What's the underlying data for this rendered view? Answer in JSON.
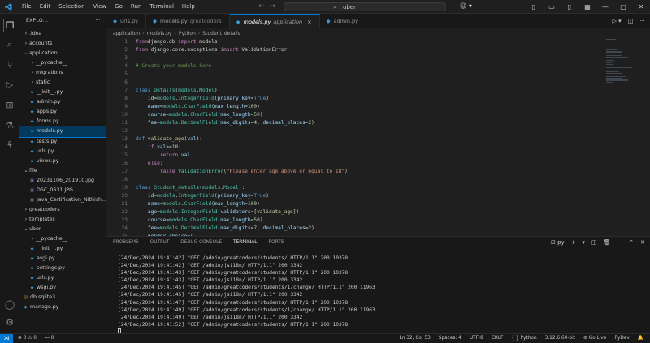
{
  "titlebar": {
    "menu": [
      "File",
      "Edit",
      "Selection",
      "View",
      "Go",
      "Run",
      "Terminal",
      "Help"
    ],
    "search": "uber"
  },
  "sidebar": {
    "header": "EXPLO...",
    "tree": [
      {
        "label": ".idea",
        "indent": 0,
        "kind": "folder",
        "open": false
      },
      {
        "label": "accounts",
        "indent": 0,
        "kind": "folder",
        "open": false
      },
      {
        "label": "application",
        "indent": 0,
        "kind": "folder",
        "open": true
      },
      {
        "label": "__pycache__",
        "indent": 1,
        "kind": "folder",
        "open": false
      },
      {
        "label": "migrations",
        "indent": 1,
        "kind": "folder",
        "open": false
      },
      {
        "label": "static",
        "indent": 1,
        "kind": "folder",
        "open": false
      },
      {
        "label": "__init__.py",
        "indent": 1,
        "kind": "py"
      },
      {
        "label": "admin.py",
        "indent": 1,
        "kind": "py"
      },
      {
        "label": "apps.py",
        "indent": 1,
        "kind": "py"
      },
      {
        "label": "forms.py",
        "indent": 1,
        "kind": "py"
      },
      {
        "label": "models.py",
        "indent": 1,
        "kind": "py",
        "selected": true
      },
      {
        "label": "tests.py",
        "indent": 1,
        "kind": "py"
      },
      {
        "label": "urls.py",
        "indent": 1,
        "kind": "py"
      },
      {
        "label": "views.py",
        "indent": 1,
        "kind": "py"
      },
      {
        "label": "file",
        "indent": 0,
        "kind": "folder",
        "open": true
      },
      {
        "label": "20231106_201910.jpg",
        "indent": 1,
        "kind": "img"
      },
      {
        "label": "DSC_0631.JPG",
        "indent": 1,
        "kind": "img"
      },
      {
        "label": "Java_Certification_Nithish...",
        "indent": 1,
        "kind": "img"
      },
      {
        "label": "greatcoders",
        "indent": 0,
        "kind": "folder",
        "open": false
      },
      {
        "label": "templates",
        "indent": 0,
        "kind": "folder",
        "open": false
      },
      {
        "label": "uber",
        "indent": 0,
        "kind": "folder",
        "open": true
      },
      {
        "label": "__pycache__",
        "indent": 1,
        "kind": "folder",
        "open": false
      },
      {
        "label": "__init__.py",
        "indent": 1,
        "kind": "py"
      },
      {
        "label": "asgi.py",
        "indent": 1,
        "kind": "py"
      },
      {
        "label": "settings.py",
        "indent": 1,
        "kind": "py"
      },
      {
        "label": "urls.py",
        "indent": 1,
        "kind": "py"
      },
      {
        "label": "wsgi.py",
        "indent": 1,
        "kind": "py"
      },
      {
        "label": "db.sqlite3",
        "indent": 0,
        "kind": "db"
      },
      {
        "label": "manage.py",
        "indent": 0,
        "kind": "py"
      }
    ]
  },
  "tabs": [
    {
      "name": "urls.py",
      "desc": "",
      "active": false
    },
    {
      "name": "models.py",
      "desc": "greatcoders",
      "active": false
    },
    {
      "name": "models.py",
      "desc": "application",
      "active": true
    },
    {
      "name": "admin.py",
      "desc": "",
      "active": false
    }
  ],
  "breadcrumbs": [
    "application",
    "models.py",
    "Python",
    "Student_details"
  ],
  "editor": {
    "lines": [
      [
        [
          "kw2",
          "from"
        ],
        [
          "",
          ""
        ],
        [
          " ",
          ""
        ],
        [
          "",
          "django.db "
        ],
        [
          "kw2",
          "import"
        ],
        [
          "",
          " models"
        ]
      ],
      [
        [
          "kw2",
          "from"
        ],
        [
          "",
          " django.core.exceptions "
        ],
        [
          "kw2",
          "import"
        ],
        [
          "",
          " ValidationError"
        ]
      ],
      [],
      [
        [
          "cmt",
          "# Create your models here"
        ]
      ],
      [],
      [],
      [
        [
          "kw",
          "class"
        ],
        [
          "",
          " "
        ],
        [
          "cls",
          "Details"
        ],
        [
          "",
          "("
        ],
        [
          "mod",
          "models"
        ],
        [
          "",
          "."
        ],
        [
          "cls",
          "Model"
        ],
        [
          "",
          "):"
        ]
      ],
      [
        [
          "",
          "    "
        ],
        [
          "var",
          "id"
        ],
        [
          "",
          "="
        ],
        [
          "mod",
          "models"
        ],
        [
          "",
          "."
        ],
        [
          "cls",
          "IntegerField"
        ],
        [
          "",
          "("
        ],
        [
          "var",
          "primary_key"
        ],
        [
          "",
          "="
        ],
        [
          "const",
          "True"
        ],
        [
          "",
          ")"
        ]
      ],
      [
        [
          "",
          "    "
        ],
        [
          "var",
          "name"
        ],
        [
          "",
          "="
        ],
        [
          "mod",
          "models"
        ],
        [
          "",
          "."
        ],
        [
          "cls",
          "CharField"
        ],
        [
          "",
          "("
        ],
        [
          "var",
          "max_length"
        ],
        [
          "",
          "="
        ],
        [
          "num",
          "100"
        ],
        [
          "",
          ")"
        ]
      ],
      [
        [
          "",
          "    "
        ],
        [
          "var",
          "course"
        ],
        [
          "",
          "="
        ],
        [
          "mod",
          "models"
        ],
        [
          "",
          "."
        ],
        [
          "cls",
          "CharField"
        ],
        [
          "",
          "("
        ],
        [
          "var",
          "max_length"
        ],
        [
          "",
          "="
        ],
        [
          "num",
          "50"
        ],
        [
          "",
          ")"
        ]
      ],
      [
        [
          "",
          "    "
        ],
        [
          "var",
          "fee"
        ],
        [
          "",
          "="
        ],
        [
          "mod",
          "models"
        ],
        [
          "",
          "."
        ],
        [
          "cls",
          "DecimalField"
        ],
        [
          "",
          "("
        ],
        [
          "var",
          "max_digits"
        ],
        [
          "",
          "="
        ],
        [
          "num",
          "4"
        ],
        [
          "",
          ", "
        ],
        [
          "var",
          "decimal_places"
        ],
        [
          "",
          "="
        ],
        [
          "num",
          "2"
        ],
        [
          "",
          ")"
        ]
      ],
      [],
      [
        [
          "kw",
          "def"
        ],
        [
          "",
          " "
        ],
        [
          "fn",
          "validate_age"
        ],
        [
          "",
          "("
        ],
        [
          "var",
          "val"
        ],
        [
          "",
          "):"
        ]
      ],
      [
        [
          "",
          "    "
        ],
        [
          "kw2",
          "if"
        ],
        [
          "",
          " "
        ],
        [
          "var",
          "val"
        ],
        [
          "",
          ">="
        ],
        [
          "num",
          "18"
        ],
        [
          "",
          ":"
        ]
      ],
      [
        [
          "",
          "        "
        ],
        [
          "kw2",
          "return"
        ],
        [
          "",
          " "
        ],
        [
          "var",
          "val"
        ]
      ],
      [
        [
          "",
          "    "
        ],
        [
          "kw2",
          "else"
        ],
        [
          "",
          ":"
        ]
      ],
      [
        [
          "",
          "        "
        ],
        [
          "kw2",
          "raise"
        ],
        [
          "",
          " "
        ],
        [
          "cls",
          "ValidationError"
        ],
        [
          "",
          "("
        ],
        [
          "str",
          "\"Please enter age above or equal to 18\""
        ],
        [
          "",
          ")"
        ]
      ],
      [],
      [
        [
          "kw",
          "class"
        ],
        [
          "",
          " "
        ],
        [
          "cls",
          "Student_details"
        ],
        [
          "",
          "("
        ],
        [
          "mod",
          "models"
        ],
        [
          "",
          "."
        ],
        [
          "cls",
          "Model"
        ],
        [
          "",
          "):"
        ]
      ],
      [
        [
          "",
          "    "
        ],
        [
          "var",
          "id"
        ],
        [
          "",
          "="
        ],
        [
          "mod",
          "models"
        ],
        [
          "",
          "."
        ],
        [
          "cls",
          "IntegerField"
        ],
        [
          "",
          "("
        ],
        [
          "var",
          "primary_key"
        ],
        [
          "",
          "="
        ],
        [
          "const",
          "True"
        ],
        [
          "",
          ")"
        ]
      ],
      [
        [
          "",
          "    "
        ],
        [
          "var",
          "name"
        ],
        [
          "",
          "="
        ],
        [
          "mod",
          "models"
        ],
        [
          "",
          "."
        ],
        [
          "cls",
          "CharField"
        ],
        [
          "",
          "("
        ],
        [
          "var",
          "max_length"
        ],
        [
          "",
          "="
        ],
        [
          "num",
          "100"
        ],
        [
          "",
          ")"
        ]
      ],
      [
        [
          "",
          "    "
        ],
        [
          "var",
          "age"
        ],
        [
          "",
          "="
        ],
        [
          "mod",
          "models"
        ],
        [
          "",
          "."
        ],
        [
          "cls",
          "IntegerField"
        ],
        [
          "",
          "("
        ],
        [
          "var",
          "validators"
        ],
        [
          "",
          "=["
        ],
        [
          "fn",
          "validate_age"
        ],
        [
          "",
          "])"
        ]
      ],
      [
        [
          "",
          "    "
        ],
        [
          "var",
          "course"
        ],
        [
          "",
          "="
        ],
        [
          "mod",
          "models"
        ],
        [
          "",
          "."
        ],
        [
          "cls",
          "CharField"
        ],
        [
          "",
          "("
        ],
        [
          "var",
          "max_length"
        ],
        [
          "",
          "="
        ],
        [
          "num",
          "50"
        ],
        [
          "",
          ")"
        ]
      ],
      [
        [
          "",
          "    "
        ],
        [
          "var",
          "fee"
        ],
        [
          "",
          "="
        ],
        [
          "mod",
          "models"
        ],
        [
          "",
          "."
        ],
        [
          "cls",
          "DecimalField"
        ],
        [
          "",
          "("
        ],
        [
          "var",
          "max_digits"
        ],
        [
          "",
          "="
        ],
        [
          "num",
          "7"
        ],
        [
          "",
          ", "
        ],
        [
          "var",
          "decimal_places"
        ],
        [
          "",
          "="
        ],
        [
          "num",
          "2"
        ],
        [
          "",
          ")"
        ]
      ],
      [
        [
          "",
          "    "
        ],
        [
          "var",
          "gender_choice"
        ],
        [
          "",
          "=["
        ]
      ]
    ]
  },
  "panel": {
    "tabs": [
      "PROBLEMS",
      "OUTPUT",
      "DEBUG CONSOLE",
      "TERMINAL",
      "PORTS"
    ],
    "active_tab": "TERMINAL",
    "shell": "py",
    "lines": [
      "[24/Dec/2024 19:41:42] \"GET /admin/greatcoders/students/ HTTP/1.1\" 200 10378",
      "[24/Dec/2024 19:41:42] \"GET /admin/jsi18n/ HTTP/1.1\" 200 3342",
      "[24/Dec/2024 19:41:43] \"GET /admin/greatcoders/students/ HTTP/1.1\" 200 10378",
      "[24/Dec/2024 19:41:43] \"GET /admin/jsi18n/ HTTP/1.1\" 200 3342",
      "[24/Dec/2024 19:41:45] \"GET /admin/greatcoders/students/1/change/ HTTP/1.1\" 200 11963",
      "[24/Dec/2024 19:41:45] \"GET /admin/jsi18n/ HTTP/1.1\" 200 3342",
      "[24/Dec/2024 19:41:47] \"GET /admin/greatcoders/students/ HTTP/1.1\" 200 10378",
      "[24/Dec/2024 19:41:49] \"GET /admin/greatcoders/students/1/change/ HTTP/1.1\" 200 11963",
      "[24/Dec/2024 19:41:49] \"GET /admin/jsi18n/ HTTP/1.1\" 200 3342",
      "[24/Dec/2024 19:41:52] \"GET /admin/greatcoders/students/ HTTP/1.1\" 200 10378"
    ]
  },
  "status": {
    "errors": "0",
    "warnings": "0",
    "ports": "0",
    "position": "Ln 32, Col 53",
    "spaces": "Spaces: 4",
    "encoding": "UTF-8",
    "eol": "CRLF",
    "language": "Python",
    "interpreter": "3.12.6 64-bit",
    "golive": "Go Live",
    "pydev": "PyDev"
  },
  "colors": {
    "accent": "#0078d4",
    "editor_bg": "#1f1f1f",
    "sidebar_bg": "#181818"
  }
}
